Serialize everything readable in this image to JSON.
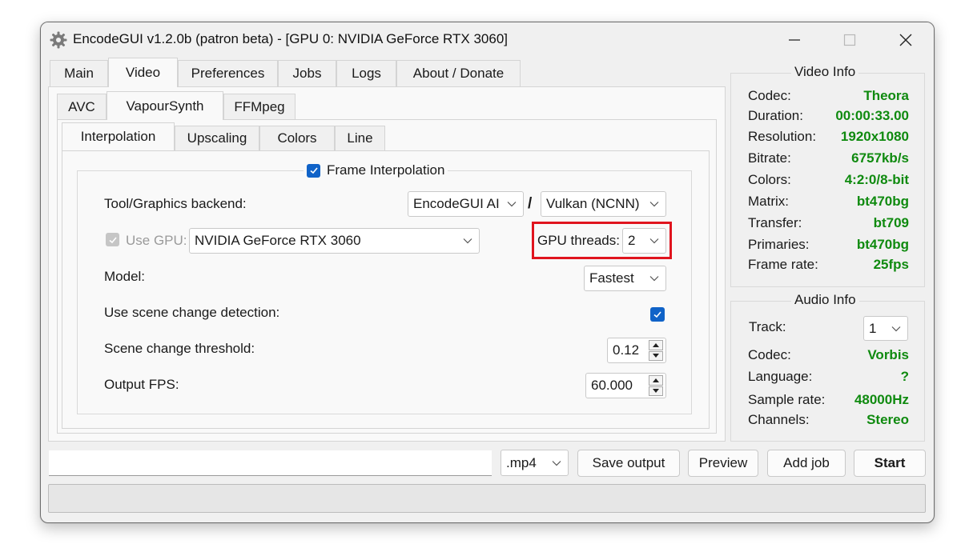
{
  "window": {
    "title": "EncodeGUI v1.2.0b (patron beta) - [GPU 0: NVIDIA GeForce RTX 3060]",
    "controls": [
      "minimize-icon",
      "maximize-icon",
      "close-icon"
    ]
  },
  "main_tabs": [
    {
      "label": "Main"
    },
    {
      "label": "Video",
      "active": true
    },
    {
      "label": "Preferences"
    },
    {
      "label": "Jobs"
    },
    {
      "label": "Logs"
    },
    {
      "label": "About / Donate"
    }
  ],
  "video_tabs": [
    {
      "label": "AVC"
    },
    {
      "label": "VapourSynth",
      "active": true
    },
    {
      "label": "FFMpeg"
    }
  ],
  "vs_tabs": [
    {
      "label": "Interpolation",
      "active": true
    },
    {
      "label": "Upscaling"
    },
    {
      "label": "Colors"
    },
    {
      "label": "Line"
    }
  ],
  "interpolation": {
    "group_title": "Frame Interpolation",
    "group_checked": true,
    "backend_label": "Tool/Graphics backend:",
    "tool_value": "EncodeGUI AI",
    "separator": "/",
    "backend_value": "Vulkan (NCNN)",
    "use_gpu_label": "Use GPU:",
    "use_gpu_checked": true,
    "gpu_value": "NVIDIA GeForce RTX 3060",
    "gpu_threads_label": "GPU threads:",
    "gpu_threads_value": "2",
    "model_label": "Model:",
    "model_value": "Fastest",
    "scene_detect_label": "Use scene change detection:",
    "scene_detect_checked": true,
    "scene_threshold_label": "Scene change threshold:",
    "scene_threshold_value": "0.12",
    "output_fps_label": "Output FPS:",
    "output_fps_value": "60.000"
  },
  "video_info": {
    "title": "Video Info",
    "rows": [
      {
        "key": "Codec:",
        "value": "Theora"
      },
      {
        "key": "Duration:",
        "value": "00:00:33.00"
      },
      {
        "key": "Resolution:",
        "value": "1920x1080"
      },
      {
        "key": "Bitrate:",
        "value": "6757kb/s"
      },
      {
        "key": "Colors:",
        "value": "4:2:0/8-bit"
      },
      {
        "key": "Matrix:",
        "value": "bt470bg"
      },
      {
        "key": "Transfer:",
        "value": "bt709"
      },
      {
        "key": "Primaries:",
        "value": "bt470bg"
      },
      {
        "key": "Frame rate:",
        "value": "25fps"
      }
    ]
  },
  "audio_info": {
    "title": "Audio Info",
    "track_label": "Track:",
    "track_value": "1",
    "rows": [
      {
        "key": "Codec:",
        "value": "Vorbis"
      },
      {
        "key": "Language:",
        "value": "?"
      },
      {
        "key": "Sample rate:",
        "value": "48000Hz"
      },
      {
        "key": "Channels:",
        "value": "Stereo"
      }
    ]
  },
  "bottom_bar": {
    "output_path_value": "",
    "container_value": ".mp4",
    "save_output_label": "Save output",
    "preview_label": "Preview",
    "add_job_label": "Add job",
    "start_label": "Start"
  },
  "colors": {
    "accent": "#1063c8",
    "info_value": "#0f8a0f",
    "highlight_box": "#e0141e"
  }
}
